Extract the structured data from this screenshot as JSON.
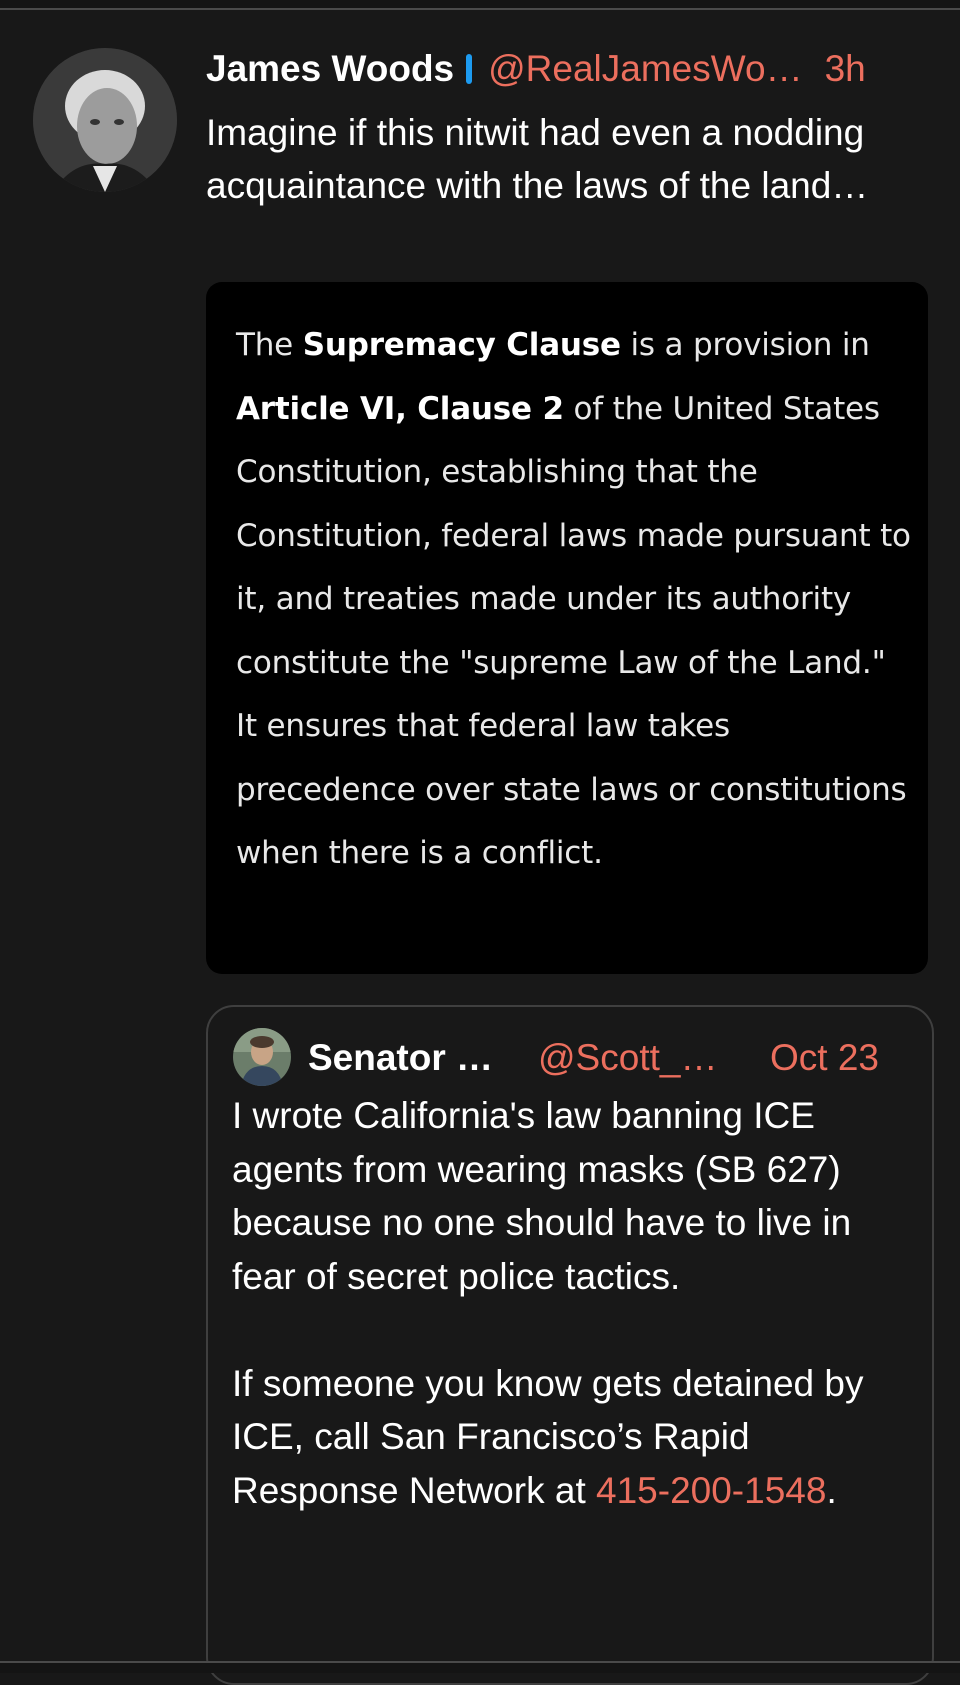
{
  "tweet": {
    "author_name": "James Woods",
    "author_handle": "@RealJamesWo…",
    "time": "3h",
    "text": "Imagine if this nitwit had even a nodding acquaintance with the laws of the land…",
    "verified_icon": "verified-badge",
    "image_text": {
      "t1": "The ",
      "b1": "Supremacy Clause",
      "t2": " is a provision in ",
      "b2": "Article VI, Clause 2",
      "t3": " of the United States Constitution, establishing that the Constitution, federal laws made pursuant to it, and treaties made under its authority constitute the \"supreme Law of the Land.\" It ensures that federal law takes precedence over state laws or constitutions when there is a conflict."
    }
  },
  "quoted": {
    "author_name": "Senator …",
    "author_handle": "@Scott_…",
    "date": "Oct 23",
    "paragraph1": "I wrote California's law banning ICE agents from wearing masks (SB 627) because no one should have to live in fear of secret police tactics.",
    "paragraph2_prefix": "If someone you know gets detained by ICE, call San Francisco’s Rapid Response Network at ",
    "phone": "415-200-1548",
    "paragraph2_suffix": "."
  },
  "colors": {
    "background": "#181818",
    "accent": "#ec6f5e",
    "verified": "#1d9bf0"
  }
}
